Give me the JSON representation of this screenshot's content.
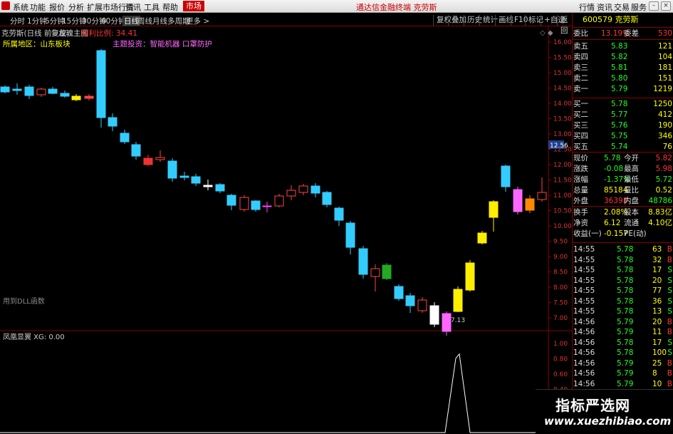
{
  "menubar": {
    "items": [
      "系统",
      "功能",
      "报价",
      "分析",
      "扩展市场行情",
      "资讯",
      "工具",
      "帮助",
      "市场"
    ],
    "title": "通达信金融终端  克劳斯",
    "right_tabs": [
      "行情",
      "资讯",
      "交易",
      "服务"
    ]
  },
  "toolbar": {
    "periods": [
      "分时",
      "1分钟",
      "5分钟",
      "15分钟",
      "30分钟",
      "60分钟",
      "日线",
      "周线",
      "月线",
      "多周期",
      "更多 >"
    ],
    "selected_period": "日线",
    "buttons": [
      "复权",
      "叠加",
      "历史",
      "统计",
      "画线",
      "F10",
      "标记",
      "+自选",
      "返回"
    ]
  },
  "chart": {
    "header_name": "克劳斯(日线 前复权)",
    "indicator_name": "龙魂主图",
    "indicator_value": "获利比例: 34.41",
    "region": "所属地区：山东板块",
    "theme": "主题投资：智能机器 口罩防护",
    "low_label": "7.13",
    "price_tag": "12.56",
    "bottom_label": "用到DLL函数",
    "ticks": [
      "16.00",
      "15.50",
      "15.00",
      "14.50",
      "14.00",
      "13.50",
      "13.00",
      "12.50",
      "12.00",
      "11.50",
      "11.00",
      "10.50",
      "10.00",
      "9.50",
      "9.00",
      "8.50",
      "8.00",
      "7.50",
      "7.00"
    ],
    "bullish_color": "#ff44ff",
    "bearish_color": "#33ccff"
  },
  "subchart": {
    "title": "凤凰显翼 XG: 0.00",
    "ticks": [
      "1.00",
      "0.80",
      "0.60",
      "0.40",
      "0.20"
    ]
  },
  "quote": {
    "code": "600579",
    "name": "克劳斯",
    "weibi_label": "委比",
    "weibi": "13.19%",
    "weicha_label": "委差",
    "weicha": "530",
    "sells": [
      {
        "label": "卖五",
        "price": "5.83",
        "vol": "121"
      },
      {
        "label": "卖四",
        "price": "5.82",
        "vol": "104"
      },
      {
        "label": "卖三",
        "price": "5.81",
        "vol": "181"
      },
      {
        "label": "卖二",
        "price": "5.80",
        "vol": "151"
      },
      {
        "label": "卖一",
        "price": "5.79",
        "vol": "1219"
      }
    ],
    "buys": [
      {
        "label": "买一",
        "price": "5.78",
        "vol": "1250"
      },
      {
        "label": "买二",
        "price": "5.77",
        "vol": "412"
      },
      {
        "label": "买三",
        "price": "5.76",
        "vol": "190"
      },
      {
        "label": "买四",
        "price": "5.75",
        "vol": "346"
      },
      {
        "label": "买五",
        "price": "5.74",
        "vol": "76"
      }
    ],
    "stats": [
      {
        "l1": "现价",
        "v1": "5.78",
        "c1": "grn",
        "l2": "今开",
        "v2": "5.82",
        "c2": "red"
      },
      {
        "l1": "涨跌",
        "v1": "-0.08",
        "c1": "grn",
        "l2": "最高",
        "v2": "5.98",
        "c2": "red"
      },
      {
        "l1": "涨幅",
        "v1": "-1.37%",
        "c1": "grn",
        "l2": "最低",
        "v2": "5.72",
        "c2": "grn"
      },
      {
        "l1": "总量",
        "v1": "85184",
        "c1": "yel",
        "l2": "量比",
        "v2": "0.52",
        "c2": "yel"
      },
      {
        "l1": "外盘",
        "v1": "36398",
        "c1": "red",
        "l2": "内盘",
        "v2": "48786",
        "c2": "grn"
      }
    ],
    "stats2": [
      {
        "l1": "换手",
        "v1": "2.08%",
        "l2": "股本",
        "v2": "8.83亿"
      },
      {
        "l1": "净资",
        "v1": "6.12",
        "l2": "流通",
        "v2": "4.10亿"
      },
      {
        "l1": "收益(一)",
        "v1": "-0.157",
        "l2": "PE(动)",
        "v2": ""
      }
    ],
    "ticks": [
      {
        "t": "14:55",
        "p": "5.78",
        "v": "63",
        "s": "B"
      },
      {
        "t": "14:55",
        "p": "5.78",
        "v": "32",
        "s": "B"
      },
      {
        "t": "14:55",
        "p": "5.78",
        "v": "17",
        "s": "S"
      },
      {
        "t": "14:55",
        "p": "5.78",
        "v": "20",
        "s": "S"
      },
      {
        "t": "14:55",
        "p": "5.78",
        "v": "77",
        "s": "S"
      },
      {
        "t": "14:55",
        "p": "5.78",
        "v": "36",
        "s": "S"
      },
      {
        "t": "14:55",
        "p": "5.78",
        "v": "13",
        "s": "S"
      },
      {
        "t": "14:56",
        "p": "5.79",
        "v": "20",
        "s": "B"
      },
      {
        "t": "14:56",
        "p": "5.79",
        "v": "11",
        "s": "B"
      },
      {
        "t": "14:56",
        "p": "5.78",
        "v": "17",
        "s": "S"
      },
      {
        "t": "14:56",
        "p": "5.78",
        "v": "100",
        "s": "S"
      },
      {
        "t": "14:56",
        "p": "5.79",
        "v": "25",
        "s": "B"
      },
      {
        "t": "14:56",
        "p": "5.79",
        "v": "8",
        "s": "B"
      },
      {
        "t": "14:56",
        "p": "5.79",
        "v": "10",
        "s": "B"
      }
    ]
  },
  "watermark": {
    "big": "指标严选网",
    "small": "www.xuezhibiao.com"
  }
}
